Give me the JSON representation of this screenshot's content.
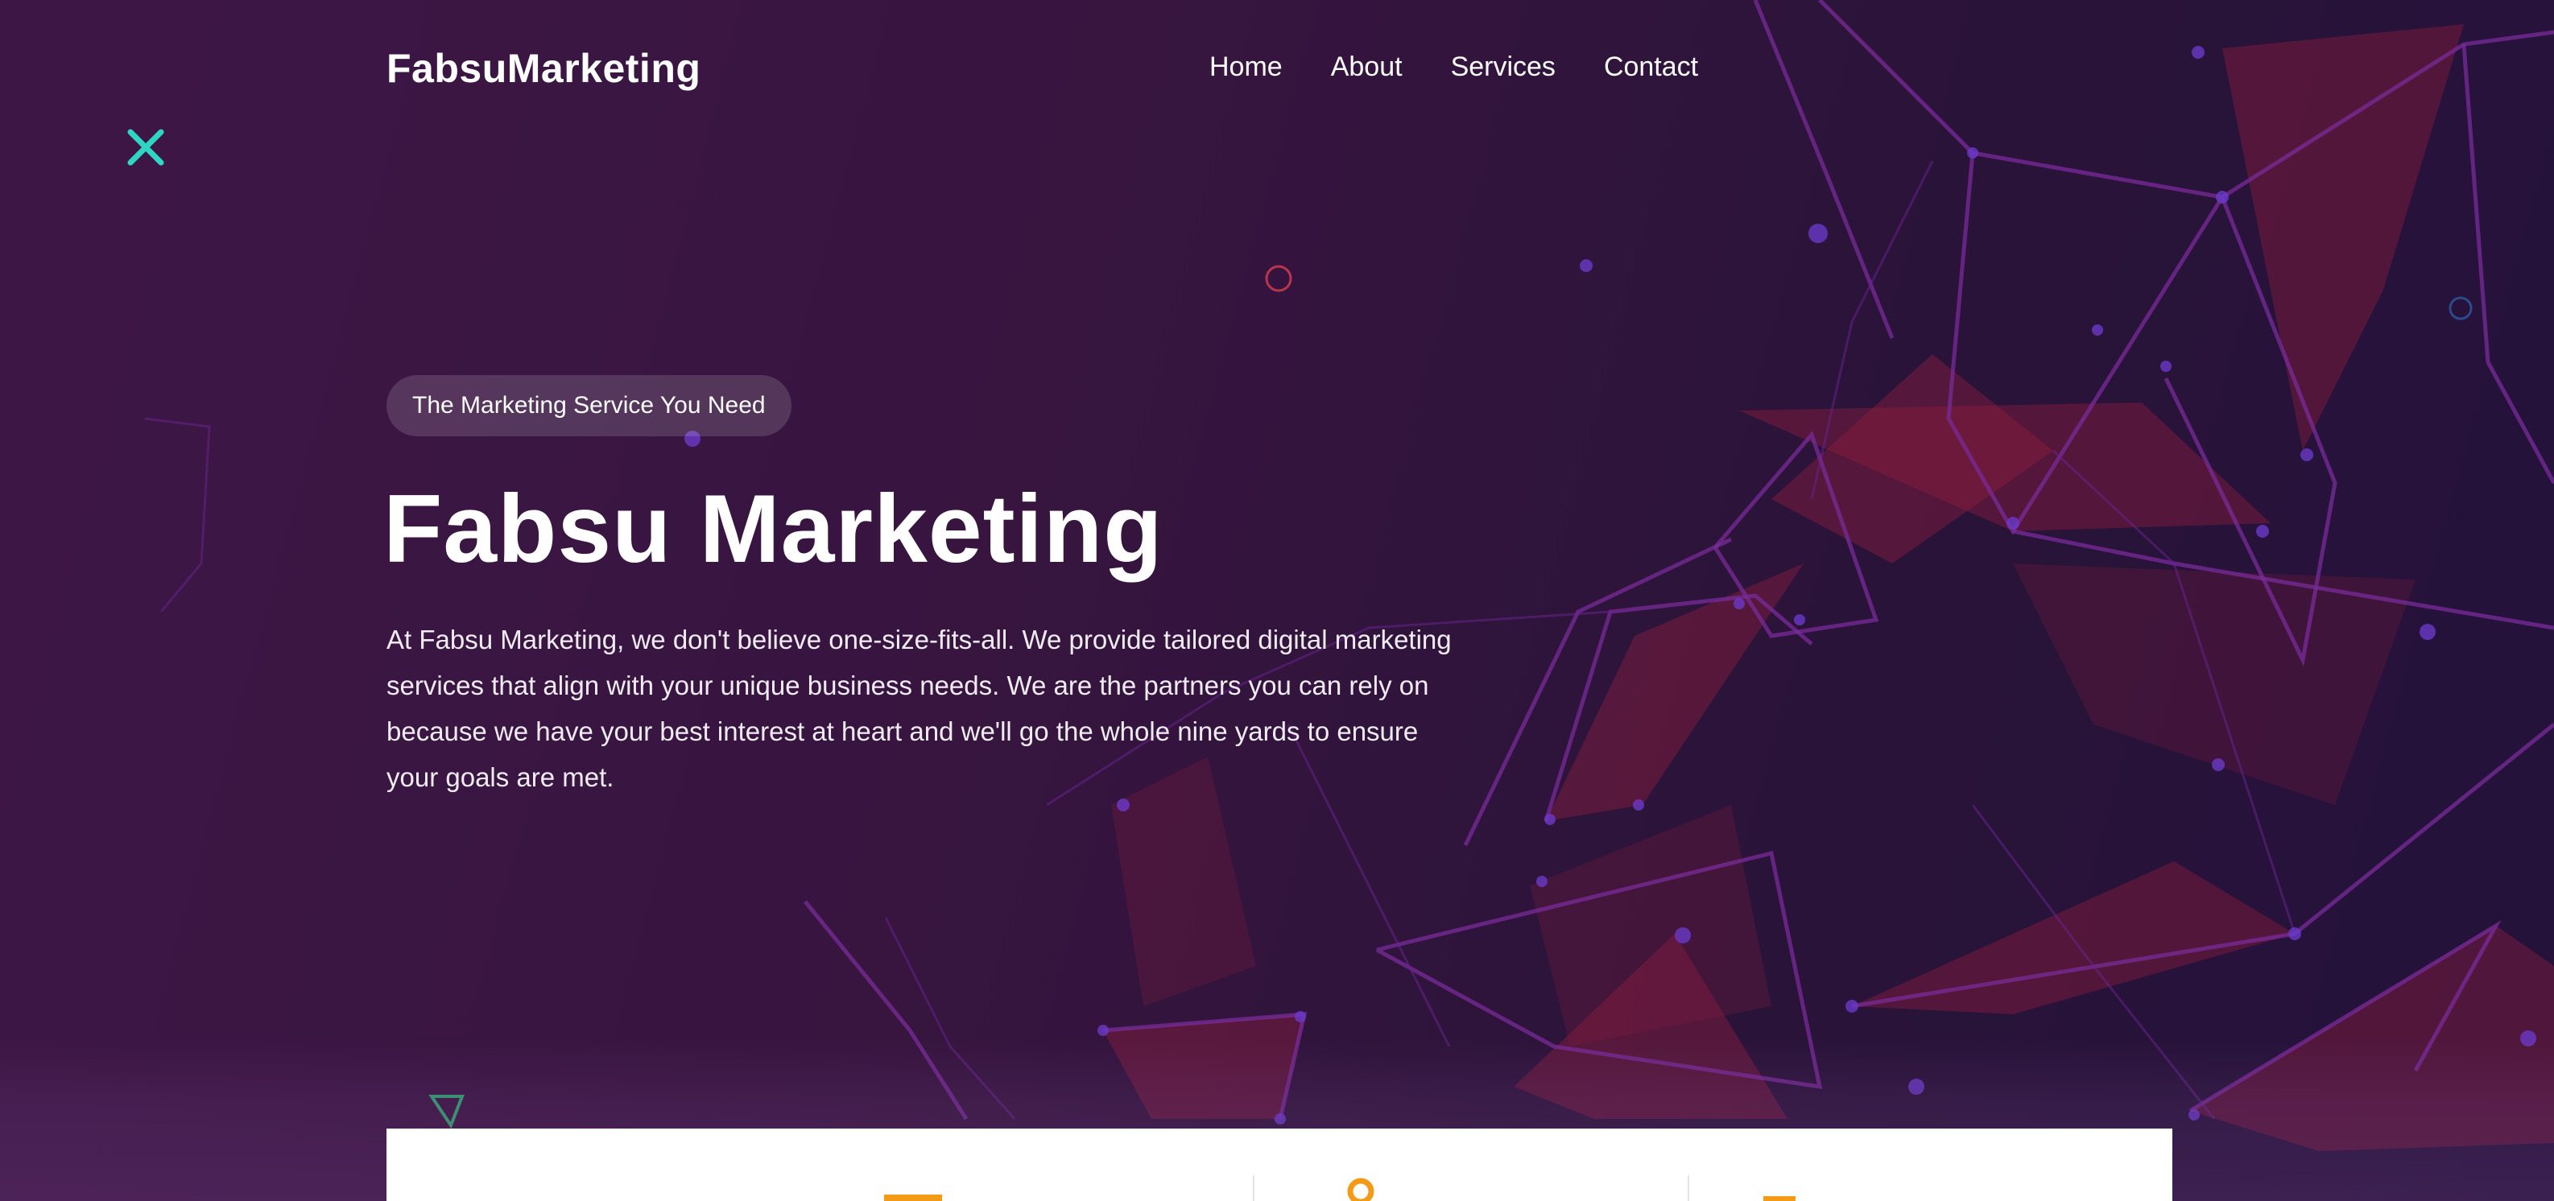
{
  "header": {
    "logo": "FabsuMarketing",
    "nav": [
      "Home",
      "About",
      "Services",
      "Contact"
    ]
  },
  "hero": {
    "badge": "The Marketing Service You Need",
    "title": "Fabsu Marketing",
    "description": "At Fabsu Marketing, we don't believe one-size-fits-all. We provide tailored digital marketing services that align with your unique business needs. We are the partners you can rely on because we have your best interest at heart and we'll go the whole nine yards to ensure your goals are met."
  },
  "icons": {
    "close": "close-icon",
    "accent_close": "#2fd6c3",
    "accent_orange": "#f39a16",
    "accent_ring": "#b8364c",
    "accent_triangle": "#2f9e6e"
  },
  "colors": {
    "background_left": "#3e1646",
    "background_right": "#23123a",
    "polygon_red": "#8a1c3e",
    "line_purple": "#7a2b9a"
  }
}
